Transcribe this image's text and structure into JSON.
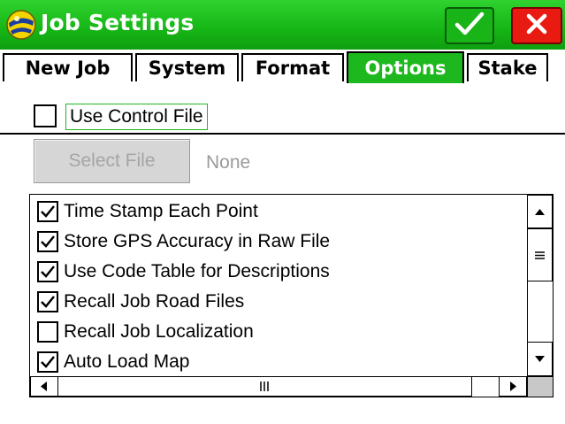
{
  "window": {
    "title": "Job Settings",
    "colors": {
      "titlebar": "#17b817",
      "ok": "#18b418",
      "close": "#e81a12",
      "active_tab": "#1db81d"
    }
  },
  "tabs": [
    {
      "label": "New Job",
      "active": false
    },
    {
      "label": "System",
      "active": false
    },
    {
      "label": "Format",
      "active": false
    },
    {
      "label": "Options",
      "active": true
    },
    {
      "label": "Stake",
      "active": false
    }
  ],
  "control_file": {
    "label": "Use Control File",
    "checked": false,
    "select_button": "Select File",
    "file_name": "None"
  },
  "options": [
    {
      "label": "Time Stamp Each Point",
      "checked": true
    },
    {
      "label": "Store GPS Accuracy in Raw File",
      "checked": true
    },
    {
      "label": "Use Code Table for Descriptions",
      "checked": true
    },
    {
      "label": "Recall Job Road Files",
      "checked": true
    },
    {
      "label": "Recall Job Localization",
      "checked": false
    },
    {
      "label": "Auto Load Map",
      "checked": true
    }
  ],
  "icons": [
    "app-logo-icon",
    "ok-check-icon",
    "close-x-icon",
    "scroll-up-arrow-icon",
    "scroll-down-arrow-icon",
    "scroll-left-arrow-icon",
    "scroll-right-arrow-icon"
  ]
}
